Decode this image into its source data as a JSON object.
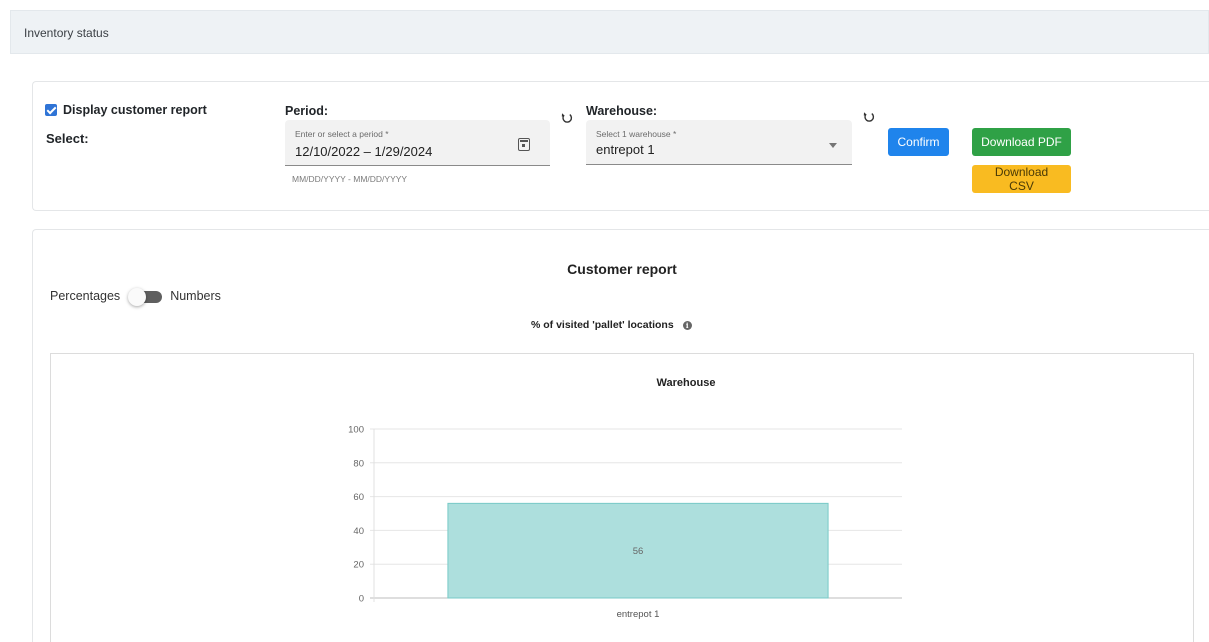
{
  "header": {
    "title": "Inventory status"
  },
  "filters": {
    "display_customer_report_label": "Display customer report",
    "display_customer_report_checked": true,
    "select_label": "Select:",
    "period": {
      "label": "Period:",
      "field_label": "Enter or select a period *",
      "value": "12/10/2022 – 1/29/2024",
      "hint": "MM/DD/YYYY - MM/DD/YYYY"
    },
    "warehouse": {
      "label": "Warehouse:",
      "field_label": "Select 1 warehouse *",
      "value": "entrepot 1"
    },
    "buttons": {
      "confirm": "Confirm",
      "download_pdf": "Download PDF",
      "download_csv": "Download CSV"
    },
    "icons": {
      "refresh": "refresh-icon",
      "calendar": "calendar-icon",
      "dropdown": "chevron-down-icon"
    }
  },
  "report": {
    "title": "Customer report",
    "toggle": {
      "left_label": "Percentages",
      "right_label": "Numbers"
    },
    "subtitle": "% of visited 'pallet' locations",
    "info_icon": "i"
  },
  "colors": {
    "confirm": "#1f84ec",
    "pdf": "#2fa146",
    "csv": "#f9bb21",
    "bar_fill": "#addfdd",
    "bar_stroke": "#78cac7",
    "checkbox": "#2f74d6"
  },
  "chart_data": {
    "type": "bar",
    "title": "Warehouse",
    "categories": [
      "entrepot 1"
    ],
    "values": [
      56
    ],
    "data_labels": [
      "56"
    ],
    "xlabel": "",
    "ylabel": "",
    "ylim": [
      0,
      100
    ],
    "yticks": [
      0,
      20,
      40,
      60,
      80,
      100
    ],
    "grid": true,
    "legend": "none"
  }
}
